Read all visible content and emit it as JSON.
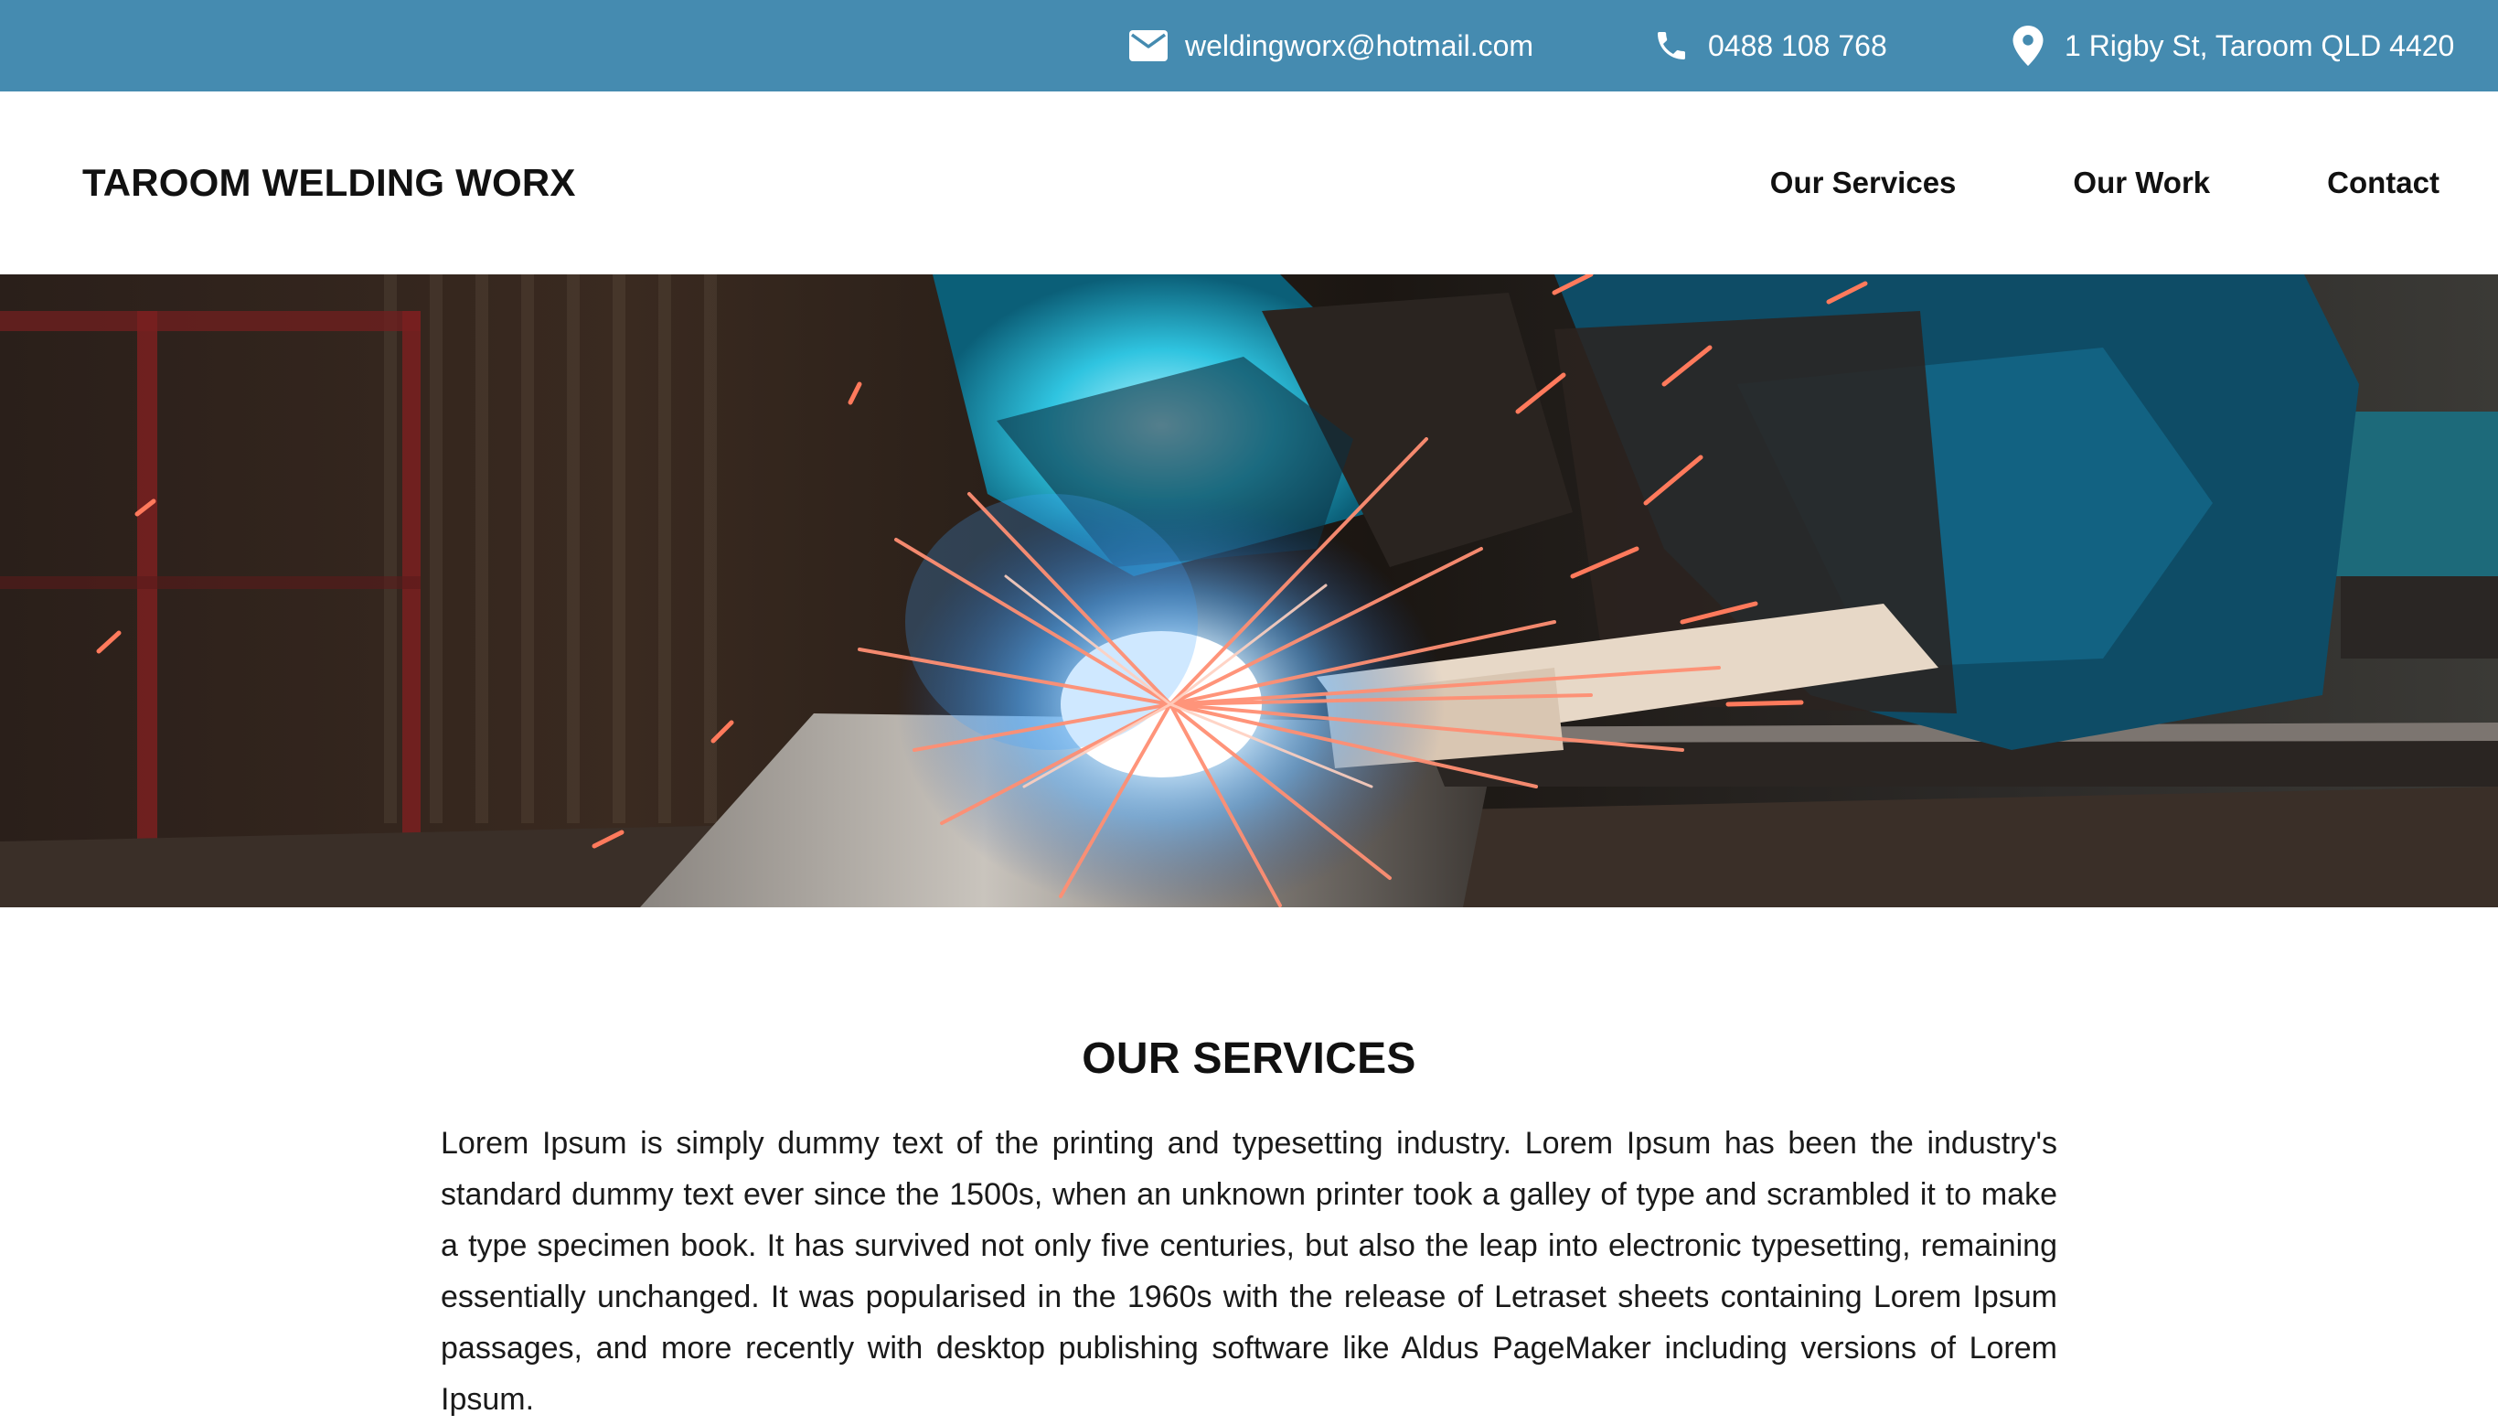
{
  "topbar": {
    "email": "weldingworx@hotmail.com",
    "phone": "0488 108 768",
    "address": "1 Rigby St, Taroom QLD 4420",
    "email_icon": "mail-icon",
    "phone_icon": "phone-icon",
    "address_icon": "location-pin-icon",
    "background_color": "#458bb0"
  },
  "header": {
    "brand": "TAROOM WELDING WORX",
    "nav": [
      {
        "label": "Our Services"
      },
      {
        "label": "Our Work"
      },
      {
        "label": "Contact"
      }
    ]
  },
  "hero": {
    "image": "welder-sparks-photo"
  },
  "services": {
    "title": "OUR SERVICES",
    "body": "Lorem Ipsum is simply dummy text of the printing and typesetting industry. Lorem Ipsum has been the industry's standard dummy text ever since the 1500s, when an unknown printer took a galley of type and scrambled it to make a type specimen book. It has survived not only five centuries, but also the leap into electronic typesetting, remaining essentially unchanged. It was popularised in the 1960s with the release of Letraset sheets containing Lorem Ipsum passages, and more recently with desktop publishing software like Aldus PageMaker including versions of Lorem Ipsum."
  }
}
